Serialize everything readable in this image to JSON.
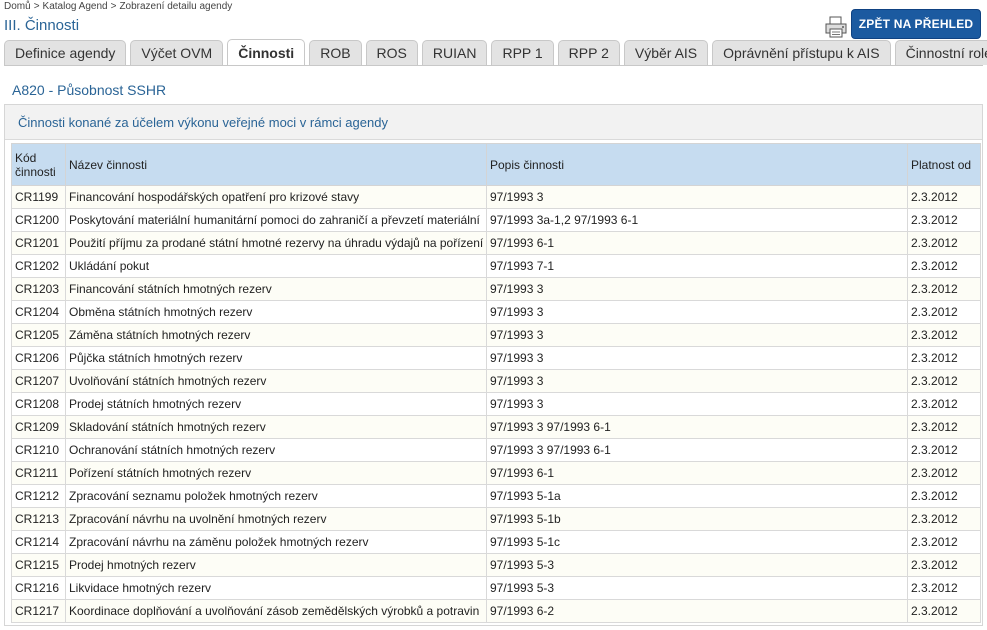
{
  "breadcrumb": [
    "Domů",
    "Katalog Agend",
    "Zobrazení detailu agendy"
  ],
  "page_title": "III. Činnosti",
  "back_button": "ZPĚT NA PŘEHLED",
  "tabs": [
    {
      "label": "Definice agendy"
    },
    {
      "label": "Výčet OVM"
    },
    {
      "label": "Činnosti",
      "active": true
    },
    {
      "label": "ROB"
    },
    {
      "label": "ROS"
    },
    {
      "label": "RUIAN"
    },
    {
      "label": "RPP 1"
    },
    {
      "label": "RPP 2"
    },
    {
      "label": "Výběr AIS"
    },
    {
      "label": "Oprávnění přístupu k AIS"
    },
    {
      "label": "Činnostní role"
    }
  ],
  "agenda_title": "A820 - Působnost SSHR",
  "panel_title": "Činnosti konané za účelem výkonu veřejné moci v rámci agendy",
  "table": {
    "headers": [
      "Kód činnosti",
      "Název činnosti",
      "Popis činnosti",
      "Platnost od"
    ],
    "rows": [
      [
        "CR1199",
        "Financování hospodářských opatření pro krizové stavy",
        "97/1993 3",
        "2.3.2012"
      ],
      [
        "CR1200",
        "Poskytování materiální humanitární pomoci do zahraničí a převzetí materiální",
        "97/1993 3a-1,2 97/1993 6-1",
        "2.3.2012"
      ],
      [
        "CR1201",
        "Použití příjmu za prodané státní hmotné rezervy na úhradu výdajů na pořízení",
        "97/1993 6-1",
        "2.3.2012"
      ],
      [
        "CR1202",
        "Ukládání pokut",
        "97/1993 7-1",
        "2.3.2012"
      ],
      [
        "CR1203",
        "Financování státních hmotných rezerv",
        "97/1993 3",
        "2.3.2012"
      ],
      [
        "CR1204",
        "Obměna státních hmotných rezerv",
        "97/1993 3",
        "2.3.2012"
      ],
      [
        "CR1205",
        "Záměna státních hmotných rezerv",
        "97/1993 3",
        "2.3.2012"
      ],
      [
        "CR1206",
        "Půjčka státních hmotných rezerv",
        "97/1993 3",
        "2.3.2012"
      ],
      [
        "CR1207",
        "Uvolňování státních hmotných rezerv",
        "97/1993 3",
        "2.3.2012"
      ],
      [
        "CR1208",
        "Prodej státních hmotných rezerv",
        "97/1993 3",
        "2.3.2012"
      ],
      [
        "CR1209",
        "Skladování státních hmotných rezerv",
        "97/1993 3 97/1993 6-1",
        "2.3.2012"
      ],
      [
        "CR1210",
        "Ochranování státních hmotných rezerv",
        "97/1993 3 97/1993 6-1",
        "2.3.2012"
      ],
      [
        "CR1211",
        "Pořízení státních hmotných rezerv",
        "97/1993 6-1",
        "2.3.2012"
      ],
      [
        "CR1212",
        "Zpracování seznamu položek hmotných rezerv",
        "97/1993 5-1a",
        "2.3.2012"
      ],
      [
        "CR1213",
        "Zpracování návrhu na uvolnění hmotných rezerv",
        "97/1993 5-1b",
        "2.3.2012"
      ],
      [
        "CR1214",
        "Zpracování návrhu na záměnu položek hmotných rezerv",
        "97/1993 5-1c",
        "2.3.2012"
      ],
      [
        "CR1215",
        "Prodej hmotných rezerv",
        "97/1993 5-3",
        "2.3.2012"
      ],
      [
        "CR1216",
        "Likvidace hmotných rezerv",
        "97/1993 5-3",
        "2.3.2012"
      ],
      [
        "CR1217",
        "Koordinace doplňování a uvolňování zásob zemědělských výrobků a potravin",
        "97/1993 6-2",
        "2.3.2012"
      ]
    ]
  }
}
